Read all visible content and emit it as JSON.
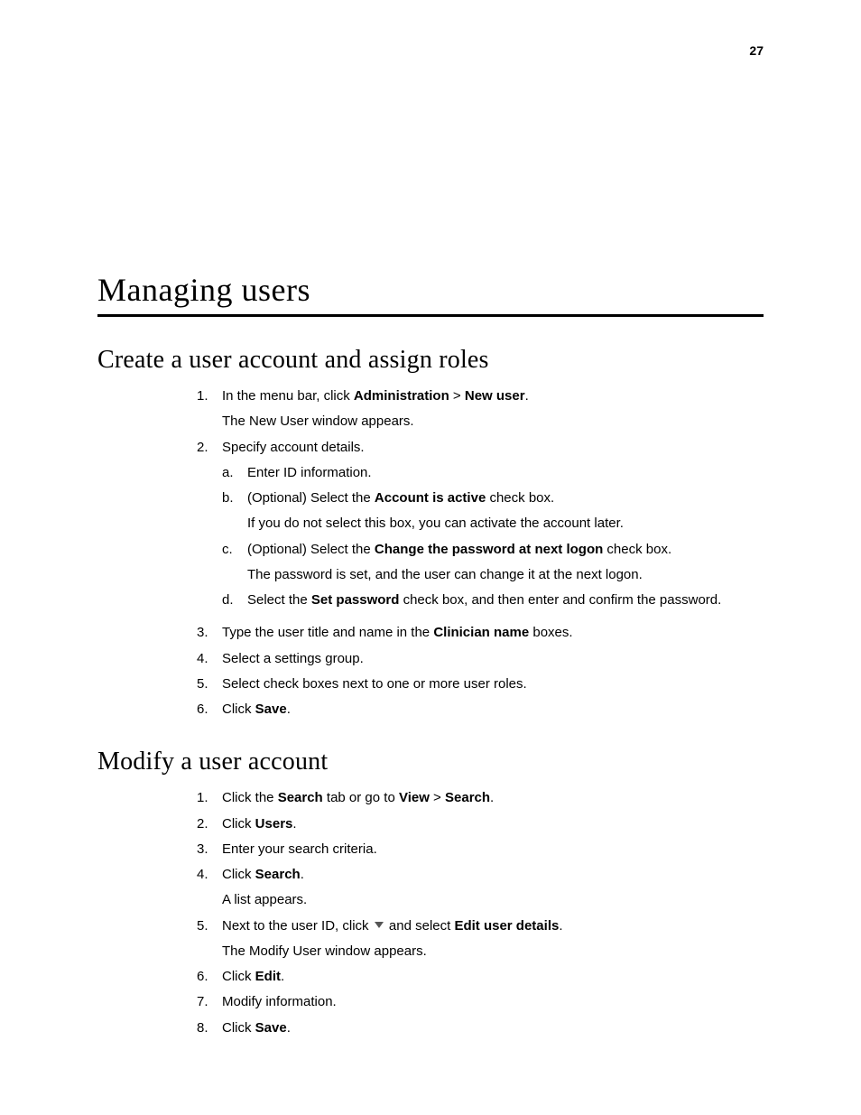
{
  "page_number": "27",
  "title": "Managing users",
  "section1": {
    "heading": "Create a user account and assign roles",
    "s1": {
      "n": "1.",
      "t1": "In the menu bar, click ",
      "b1": "Administration",
      "t2": " > ",
      "b2": "New user",
      "t3": ".",
      "f": "The New User window appears."
    },
    "s2": {
      "n": "2.",
      "t": "Specify account details.",
      "a": {
        "n": "a.",
        "t": "Enter ID information."
      },
      "b": {
        "n": "b.",
        "t1": "(Optional) Select the ",
        "b1": "Account is active",
        "t2": " check box.",
        "f": "If you do not select this box, you can activate the account later."
      },
      "c": {
        "n": "c.",
        "t1": "(Optional) Select the ",
        "b1": "Change the password at next logon",
        "t2": " check box.",
        "f": "The password is set, and the user can change it at the next logon."
      },
      "d": {
        "n": "d.",
        "t1": "Select the ",
        "b1": "Set password",
        "t2": " check box, and then enter and confirm the password."
      }
    },
    "s3": {
      "n": "3.",
      "t1": "Type the user title and name in the ",
      "b1": "Clinician name",
      "t2": " boxes."
    },
    "s4": {
      "n": "4.",
      "t": "Select a settings group."
    },
    "s5": {
      "n": "5.",
      "t": "Select check boxes next to one or more user roles."
    },
    "s6": {
      "n": "6.",
      "t1": "Click ",
      "b1": "Save",
      "t2": "."
    }
  },
  "section2": {
    "heading": "Modify a user account",
    "s1": {
      "n": "1.",
      "t1": "Click the ",
      "b1": "Search",
      "t2": " tab or go to ",
      "b2": "View",
      "t3": " > ",
      "b3": "Search",
      "t4": "."
    },
    "s2": {
      "n": "2.",
      "t1": "Click ",
      "b1": "Users",
      "t2": "."
    },
    "s3": {
      "n": "3.",
      "t": "Enter your search criteria."
    },
    "s4": {
      "n": "4.",
      "t1": "Click ",
      "b1": "Search",
      "t2": ".",
      "f": "A list appears."
    },
    "s5": {
      "n": "5.",
      "t1": "Next to the user ID, click ",
      "t2": " and select ",
      "b1": "Edit user details",
      "t3": ".",
      "f": "The Modify User window appears."
    },
    "s6": {
      "n": "6.",
      "t1": "Click ",
      "b1": "Edit",
      "t2": "."
    },
    "s7": {
      "n": "7.",
      "t": "Modify information."
    },
    "s8": {
      "n": "8.",
      "t1": "Click ",
      "b1": "Save",
      "t2": "."
    }
  }
}
